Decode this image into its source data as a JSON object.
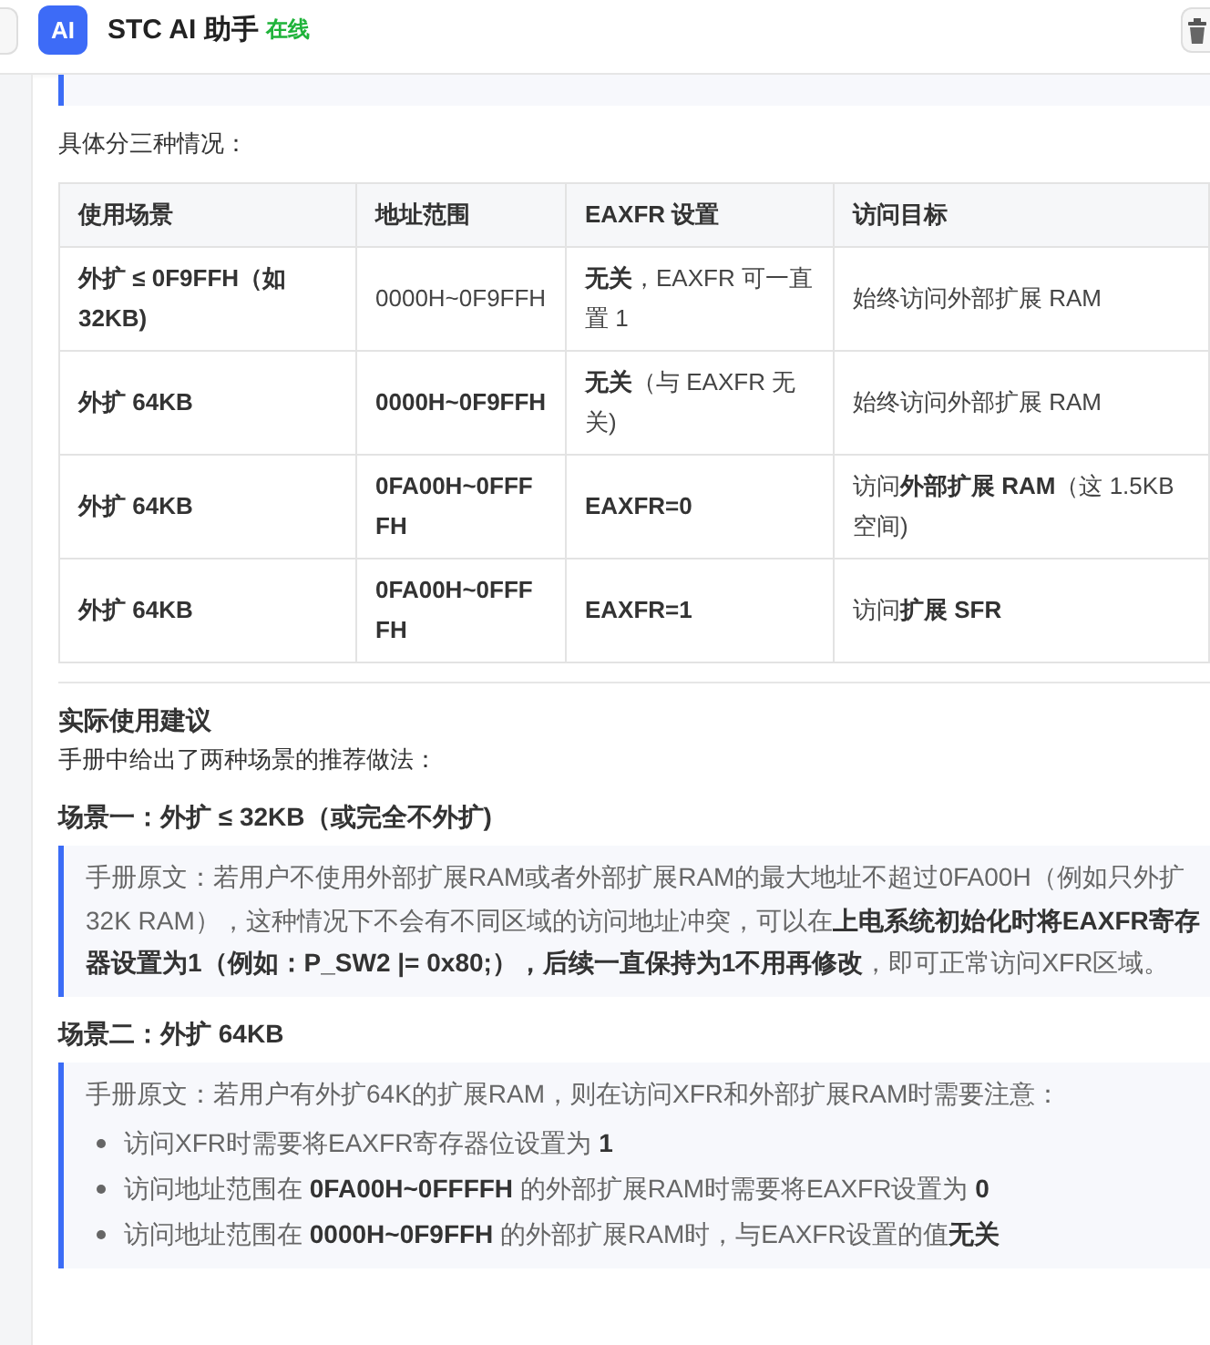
{
  "header": {
    "logo": "AI",
    "title": "STC AI 助手",
    "status": "在线"
  },
  "intro": "具体分三种情况：",
  "table": {
    "columns": [
      "使用场景",
      "地址范围",
      "EAXFR 设置",
      "访问目标"
    ],
    "rows": [
      [
        {
          "text": "外扩 ≤ 0F9FFH（如 32KB)",
          "bold": true
        },
        {
          "text": "0000H~0F9FFH",
          "bold": false
        },
        {
          "text": "**无关**，EAXFR 可一直置 1",
          "bold": false
        },
        {
          "text": "始终访问外部扩展 RAM",
          "bold": false
        }
      ],
      [
        {
          "text": "外扩 64KB",
          "bold": true
        },
        {
          "text": "0000H~0F9FFH",
          "bold": true
        },
        {
          "text": "**无关**（与 EAXFR 无关)",
          "bold": false
        },
        {
          "text": "始终访问外部扩展 RAM",
          "bold": false
        }
      ],
      [
        {
          "text": "外扩 64KB",
          "bold": true
        },
        {
          "text": "0FA00H~0FFFFH",
          "bold": true
        },
        {
          "text": "EAXFR=0",
          "bold": true
        },
        {
          "text": "访问**外部扩展 RAM**（这 1.5KB 空间)",
          "bold": false
        }
      ],
      [
        {
          "text": "外扩 64KB",
          "bold": true
        },
        {
          "text": "0FA00H~0FFFFH",
          "bold": true
        },
        {
          "text": "EAXFR=1",
          "bold": true
        },
        {
          "text": "访问**扩展 SFR**",
          "bold": false
        }
      ]
    ]
  },
  "section_title": "实际使用建议",
  "section_intro": "手册中给出了两种场景的推荐做法：",
  "scenarios": [
    {
      "title": "场景一：外扩 ≤ 32KB（或完全不外扩)",
      "quote": "手册原文：若用户不使用外部扩展RAM或者外部扩展RAM的最大地址不超过0FA00H（例如只外扩32K RAM），这种情况下不会有不同区域的访问地址冲突，可以在**上电系统初始化时将EAXFR寄存器设置为1（例如：P_SW2 |= 0x80;），后续一直保持为1不用再修改**，即可正常访问XFR区域。"
    },
    {
      "title": "场景二：外扩 64KB",
      "quote": "手册原文：若用户有外扩64K的扩展RAM，则在访问XFR和外部扩展RAM时需要注意：",
      "bullets": [
        "访问XFR时需要将EAXFR寄存器位设置为 **1**",
        "访问地址范围在 **0FA00H~0FFFFH** 的外部扩展RAM时需要将EAXFR设置为 **0**",
        "访问地址范围在 **0000H~0F9FFH** 的外部扩展RAM时，与EAXFR设置的值**无关**"
      ]
    }
  ]
}
